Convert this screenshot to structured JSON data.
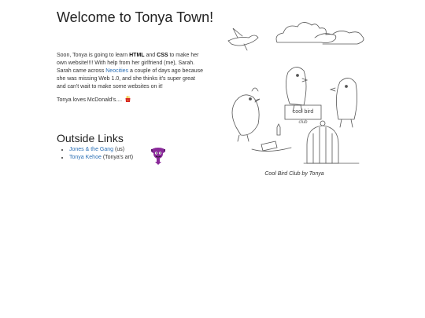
{
  "page": {
    "title": "Welcome to Tonya Town!"
  },
  "intro": {
    "text_1": "Soon, Tonya is going to learn ",
    "html_label": "HTML",
    "text_2": " and ",
    "css_label": "CSS",
    "text_3": " to make her own website!!!! With help from her girlfriend (me), Sarah. Sarah came across ",
    "neocities_link": "Neocities",
    "text_4": " a couple of days ago because she was missing Web 1.0, and she thinks it's super great and can't wait to make some websites on it!"
  },
  "loves": {
    "text": "Tonya loves McDonald's.... ",
    "icon": "fries-icon"
  },
  "outside_links": {
    "heading": "Outside Links",
    "items": [
      {
        "link": "Jones & the Gang",
        "note": " (us)"
      },
      {
        "link": "Tonya Kehoe",
        "note": " (Tonya's art)"
      }
    ],
    "badge_icon": "purple-creature-icon"
  },
  "art": {
    "image_icon": "bird-club-sketch",
    "sign_text": "cool bird",
    "sign_text_2": "club",
    "caption": "Cool Bird Club by Tonya"
  },
  "colors": {
    "link": "#2a6fb5",
    "text": "#222222",
    "badge": "#8a2a9a"
  }
}
